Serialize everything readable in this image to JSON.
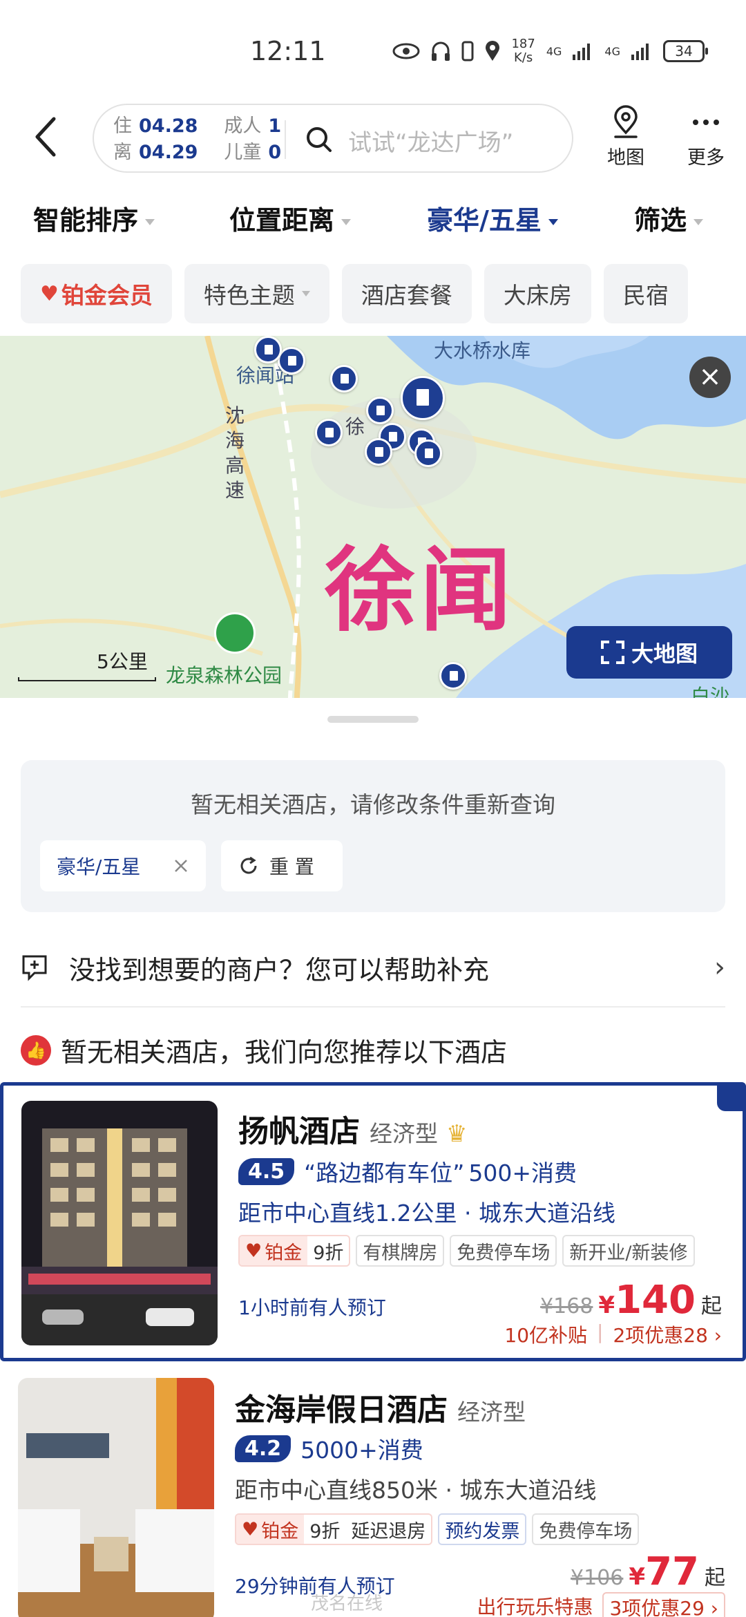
{
  "status_bar": {
    "time": "12:11",
    "network_speed": "187",
    "network_speed_unit": "K/s",
    "signal_1": "4G",
    "signal_2": "4G",
    "battery": "34"
  },
  "header": {
    "checkin_label": "住",
    "checkin_date": "04.28",
    "checkout_label": "离",
    "checkout_date": "04.29",
    "adult_label": "成人",
    "adult_count": "1",
    "child_label": "儿童",
    "child_count": "0",
    "search_placeholder": "试试“龙达广场”",
    "map_button": "地图",
    "more_button": "更多"
  },
  "sort_bar": {
    "items": [
      {
        "label": "智能排序",
        "active": false
      },
      {
        "label": "位置距离",
        "active": false
      },
      {
        "label": "豪华/五星",
        "active": true
      },
      {
        "label": "筛选",
        "active": false
      }
    ]
  },
  "tags": {
    "member": "铂金会员",
    "theme": "特色主题",
    "package": "酒店套餐",
    "bigbed": "大床房",
    "homestay": "民宿"
  },
  "map": {
    "city": "徐闻",
    "reservoir": "大水桥水库",
    "station": "徐闻站",
    "highway_1": "沈",
    "highway_2": "海",
    "highway_3": "高",
    "highway_4": "速",
    "park": "龙泉森林公园",
    "center_partial": "徐",
    "scale": "5公里",
    "bigmap_button": "大地图",
    "edge_label": "白沙"
  },
  "no_result": {
    "message": "暂无相关酒店，请修改条件重新查询",
    "filter_chip": "豪华/五星",
    "reset_button": "重 置"
  },
  "help_row": "没找到想要的商户？您可以帮助补充",
  "recommend_header": "暂无相关酒店，我们向您推荐以下酒店",
  "hotels": [
    {
      "name": "扬帆酒店",
      "type": "经济型",
      "score": "4.5",
      "review": "“路边都有车位”",
      "consumption": "500+消费",
      "location": "距市中心直线1.2公里 · 城东大道沿线",
      "member_badge": "铂金",
      "discount": "9折",
      "badges": [
        "有棋牌房",
        "免费停车场",
        "新开业/新装修"
      ],
      "booked": "1小时前有人预订",
      "original_price": "¥168",
      "currency": "¥",
      "price": "140",
      "price_suffix": "起",
      "promo_1": "10亿补贴",
      "promo_2": "2项优惠28 ›"
    },
    {
      "name": "金海岸假日酒店",
      "type": "经济型",
      "score": "4.2",
      "consumption": "5000+消费",
      "location": "距市中心直线850米 · 城东大道沿线",
      "member_badge": "铂金",
      "discount": "9折",
      "badges": [
        "延迟退房",
        "预约发票",
        "免费停车场"
      ],
      "booked": "29分钟前有人预订",
      "original_price": "¥106",
      "currency": "¥",
      "price": "77",
      "price_suffix": "起",
      "promo_1": "出行玩乐特惠",
      "promo_2": "3项优惠29 ›"
    }
  ],
  "watermark": "茂名在线"
}
